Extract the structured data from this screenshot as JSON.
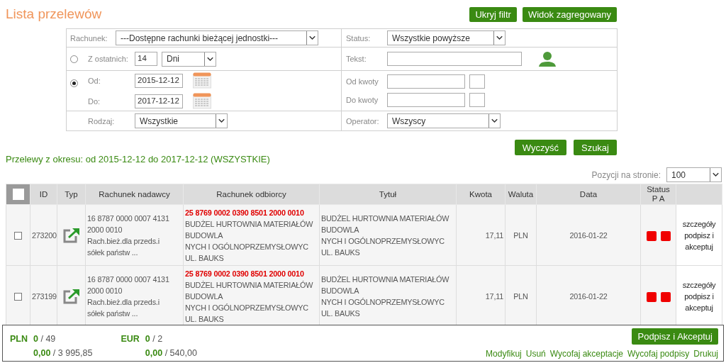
{
  "title": "Lista przelewów",
  "top_buttons": [
    "Ukryj filtr",
    "Widok zagregowany"
  ],
  "filter": {
    "account": {
      "label": "Rachunek:",
      "value": "---Dostępne rachunki bieżącej jednostki---"
    },
    "status": {
      "label": "Status:",
      "value": "Wszystkie powyższe"
    },
    "range_last": {
      "selected": false,
      "label": "Z ostatnich:",
      "count": "14",
      "unit": "Dni"
    },
    "range_dates": {
      "selected": true,
      "from_label": "Od:",
      "from": "2015-12-12",
      "to_label": "Do:",
      "to": "2017-12-12"
    },
    "text": {
      "label": "Tekst:"
    },
    "amount_from": {
      "label": "Od kwoty"
    },
    "amount_to": {
      "label": "Do kwoty"
    },
    "type": {
      "label": "Rodzaj:",
      "value": "Wszystkie"
    },
    "operator": {
      "label": "Operator:",
      "value": "Wszyscy"
    }
  },
  "filter_buttons": [
    "Wyczyść",
    "Szukaj"
  ],
  "period_text": "Przelewy z okresu: od 2015-12-12 do 2017-12-12 (WSZYSTKIE)",
  "page_size": {
    "label": "Pozycji na stronie:",
    "value": "100"
  },
  "table": {
    "select_all": {
      "checked": false
    },
    "columns": [
      {
        "label": "ID"
      },
      {
        "label": "Typ"
      },
      {
        "label": "Rachunek nadawcy"
      },
      {
        "label": "Rachunek odbiorcy"
      },
      {
        "label": "Tytuł"
      },
      {
        "label": "Kwota"
      },
      {
        "label": "Waluta"
      },
      {
        "label": "Data"
      },
      {
        "label": "Status",
        "sublabel": "P A"
      }
    ],
    "rows": [
      {
        "selected": false,
        "id": "273200",
        "sender": [
          "16 8787 0000 0007 4131",
          "2000 0010",
          "Rach.bież.dla przeds.i",
          "sółek państw ..."
        ],
        "receiver_account": "25 8769 0002 0390 8501 2000 0010",
        "receiver": [
          "BUDŻEL HURTOWNIA MATERIAŁÓW",
          "BUDOWLA",
          "NYCH I OGÓLNOPRZEMYSŁOWYC",
          "UL. BAUKS"
        ],
        "title": [
          "BUDŻEL HURTOWNIA MATERIAŁÓW",
          "BUDOWLA",
          "NYCH I OGÓLNOPRZEMYSŁOWYC",
          "UL. BAUKS"
        ],
        "amount": "17,11",
        "currency": "PLN",
        "date": "2016-01-22",
        "signed": false,
        "accepted": false,
        "actions": [
          "szczegóły",
          "podpisz i akceptuj"
        ]
      },
      {
        "selected": false,
        "id": "273199",
        "sender": [
          "16 8787 0000 0007 4131",
          "2000 0010",
          "Rach.bież.dla przeds.i",
          "sółek państw ..."
        ],
        "receiver_account": "25 8769 0002 0390 8501 2000 0010",
        "receiver": [
          "BUDŻEL HURTOWNIA MATERIAŁÓW",
          "BUDOWLA",
          "NYCH I OGÓLNOPRZEMYSŁOWYC",
          "UL. BAUKS"
        ],
        "title": [
          "BUDŻEL HURTOWNIA MATERIAŁÓW",
          "BUDOWLA",
          "NYCH I OGÓLNOPRZEMYSŁOWYC",
          "UL. BAUKS"
        ],
        "amount": "17,11",
        "currency": "PLN",
        "date": "2016-01-22",
        "signed": false,
        "accepted": false,
        "actions": [
          "szczegóły",
          "podpisz i akceptuj"
        ]
      }
    ]
  },
  "summary": {
    "totals": [
      {
        "currency": "PLN",
        "count_selected": "0",
        "count_total": "/ 49",
        "sum_selected": "0,00",
        "sum_total": "/ 3 995,85"
      },
      {
        "currency": "EUR",
        "count_selected": "0",
        "count_total": "/ 2",
        "sum_selected": "0,00",
        "sum_total": "/ 540,00"
      }
    ],
    "button": "Podpisz i Akceptuj",
    "links": [
      "Modyfikuj",
      "Usuń",
      "Wycofaj akceptacje",
      "Wycofaj podpisy",
      "Drukuj"
    ]
  }
}
